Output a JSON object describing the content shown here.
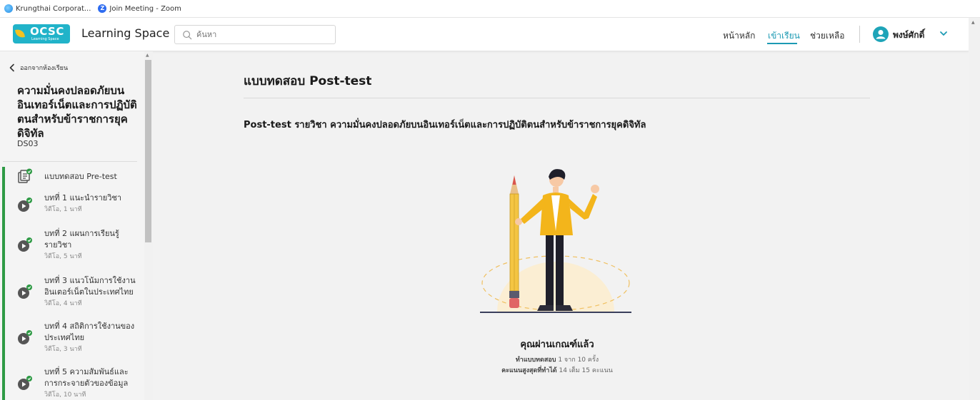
{
  "bookmarks": [
    {
      "label": "Krungthai Corporat..."
    },
    {
      "label": "Join Meeting - Zoom"
    }
  ],
  "header": {
    "logo_text": "OCSC",
    "logo_sub": "Learning Space",
    "app_title": "Learning Space",
    "search_placeholder": "ค้นหา",
    "nav": [
      {
        "label": "หน้าหลัก"
      },
      {
        "label": "เข้าเรียน"
      },
      {
        "label": "ช่วยเหลือ"
      }
    ],
    "user_name": "พงษ์ศักดิ์",
    "accent_color": "#1c9ab3"
  },
  "sidebar": {
    "back_label": "ออกจากห้องเรียน",
    "course_title": "ความมั่นคงปลอดภัยบนอินเทอร์เน็ตและการปฏิบัติตนสำหรับข้าราชการยุคดิจิทัล",
    "course_code": "DS03",
    "lessons": [
      {
        "title": "แบบทดสอบ Pre-test",
        "sub": "",
        "icon": "quiz-icon"
      },
      {
        "title": "บทที่ 1 แนะนำรายวิชา",
        "sub": "วิดีโอ, 1 นาที",
        "icon": "play-icon"
      },
      {
        "title": "บทที่ 2 แผนการเรียนรู้รายวิชา",
        "sub": "วิดีโอ, 5 นาที",
        "icon": "play-icon"
      },
      {
        "title": "บทที่ 3 แนวโน้มการใช้งานอินเตอร์เน็ตในประเทศไทย",
        "sub": "วิดีโอ, 4 นาที",
        "icon": "play-icon"
      },
      {
        "title": "บทที่ 4 สถิติการใช้งานของประเทศไทย",
        "sub": "วิดีโอ, 3 นาที",
        "icon": "play-icon"
      },
      {
        "title": "บทที่ 5 ความสัมพันธ์และการกระจายตัวของข้อมูล",
        "sub": "วิดีโอ, 10 นาที",
        "icon": "play-icon"
      }
    ],
    "complete_color": "#2e9a45"
  },
  "main": {
    "title": "แบบทดสอบ Post-test",
    "subject": "Post-test รายวิชา ความมั่นคงปลอดภัยบนอินเทอร์เน็ตและการปฏิบัติตนสำหรับข้าราชการยุคดิจิทัล",
    "pass_message": "คุณผ่านเกณฑ์แล้ว",
    "attempt_label": "ทำแบบทดสอบ",
    "attempt_value": "1 จาก 10 ครั้ง",
    "score_label": "คะแนนสูงสุดที่ทำได้",
    "score_value": "14 เต็ม 15 คะแนน"
  }
}
